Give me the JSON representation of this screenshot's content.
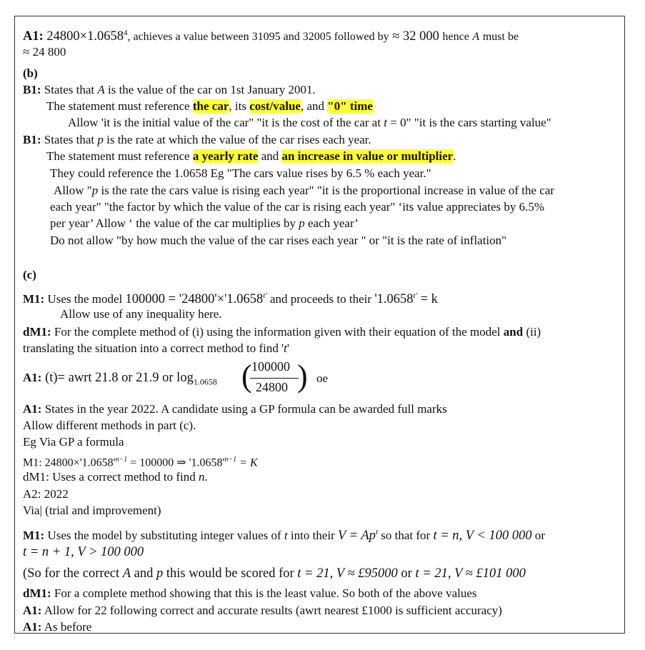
{
  "a1": {
    "label": "A1:",
    "expr": "24800×1.0658",
    "sup": "4",
    "text1": ", achieves a value between 31095 and 32005 followed by",
    "approx": " ≈ 32 000",
    "text2": "hence",
    "var": "A",
    "text3": "must be",
    "line2": "≈ 24 800"
  },
  "b": {
    "head": "(b)",
    "b1a_label": "B1:",
    "b1a_pre": "States that",
    "b1a_var": "A",
    "b1a_post": "is the value of the car on 1st January 2001.",
    "ref1_pre": "The statement must reference",
    "ref1_hl1": "the car",
    "ref1_mid1": ", its",
    "ref1_hl2": "cost/value",
    "ref1_mid2": ", and",
    "ref1_hl3": "\"0\" time",
    "allow1_pre": "Allow 'it is the initial value of the car\" \"it is the cost of the car at",
    "allow1_var": "t",
    "allow1_post": "= 0\" \"it is the cars starting value\"",
    "b1b_label": "B1:",
    "b1b_pre": "States that",
    "b1b_var": "p",
    "b1b_post": "is the rate at which the value of the car rises each year.",
    "ref2_pre": "The statement must reference",
    "ref2_hl1": "a yearly rate",
    "ref2_mid": "and",
    "ref2_hl2": "an increase in value or multiplier",
    "ref2_end": ".",
    "could": "They could reference the 1.0658 Eg \"The cars value rises by 6.5 % each year.\"",
    "allow2_l1_pre": "Allow \"",
    "allow2_l1_var": "p",
    "allow2_l1_post": "is the rate the cars value is rising each year\"  \"it is the proportional increase in value of the car",
    "allow2_l2": "each year\"   \"the factor by which the value of the car is rising each year\" ‘its value appreciates by 6.5%",
    "allow2_l3_pre": "per year’ Allow ‘ the value of the car multiplies by",
    "allow2_l3_var": "p",
    "allow2_l3_post": "each year’",
    "notallow": "Do not allow \"by how much the value of the car rises each year \" or  \"it is the rate of inflation\""
  },
  "c": {
    "head": "(c)",
    "m1_label": "M1:",
    "m1_pre": "Uses the model",
    "m1_eq": "100000 = '24800'×'1.0658",
    "m1_sup": "t'",
    "m1_mid": "and proceeds to their",
    "m1_eq2": "'1.0658",
    "m1_sup2": "t'",
    "m1_eq3": "= k",
    "m1_allow": "Allow use of any inequality here.",
    "dm1_label": "dM1:",
    "dm1_pre": "For the complete method of (i) using the information given with their equation of the model",
    "dm1_and": "and",
    "dm1_post": "(ii)",
    "dm1_l2_pre": "translating the situation into a correct method to find '",
    "dm1_l2_var": "t",
    "dm1_l2_post": "'",
    "a1_label": "A1:",
    "a1_t": "(t)",
    "a1_eq": "= awrt 21.8 or 21.9  or  log",
    "a1_base": "1.0658",
    "a1_num": "100000",
    "a1_den": "24800",
    "a1_oe": "oe",
    "a1b_label": "A1:",
    "a1b_text": "States in the year 2022.    A candidate using a GP formula can be awarded full marks",
    "diff": "Allow different methods in part (c).",
    "gp": "Eg Via GP a formula",
    "gp_m1_pre": "M1:  24800×'1.0658'",
    "gp_m1_sup1": "n−1",
    "gp_m1_mid": " = 100000 ⇒ '1.0658'",
    "gp_m1_sup2": "n−1",
    "gp_m1_post": " = K",
    "gp_dm1": "dM1: Uses a correct method to find",
    "gp_dm1_var": "n",
    "gp_dm1_end": ".",
    "gp_a2": "A2: 2022",
    "via": "Via| (trial and improvement)",
    "tm1_label": "M1:",
    "tm1_pre": "Uses the model by substituting integer values of",
    "tm1_var": "t",
    "tm1_mid": "into their",
    "tm1_eq": "V = Ap",
    "tm1_sup": "t",
    "tm1_post": "so that for",
    "tm1_cond1": "t = n, V < 100 000",
    "tm1_or": "or",
    "tm1_cond2": "t = n + 1, V > 100 000",
    "so_pre": "(So for the correct",
    "so_A": "A",
    "so_and": "and",
    "so_p": "p",
    "so_mid": "this would be scored for",
    "so_c1": "t = 21, V ≈ £95000",
    "so_or": "or",
    "so_c2": "t = 21, V ≈ £101 000",
    "tdm1_label": "dM1:",
    "tdm1_text": "For a complete method showing that this is the least value. So both of the above values",
    "ta1_label": "A1:",
    "ta1_text": "Allow for 22 following correct and accurate results (awrt nearest £1000 is sufficient accuracy)",
    "ta1b_label": "A1:",
    "ta1b_text": "As before"
  }
}
